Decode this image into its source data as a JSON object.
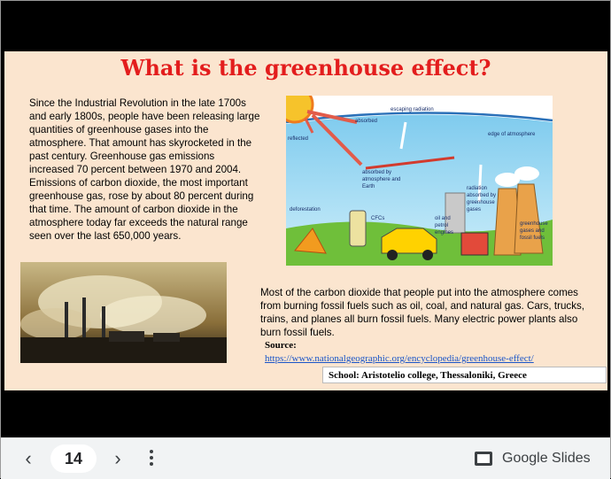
{
  "slide": {
    "title": "What is the greenhouse effect?",
    "paragraph1": "Since the Industrial Revolution in the late 1700s and early 1800s, people have been releasing large quantities of greenhouse gases into the atmosphere. That amount has skyrocketed in the past century. Greenhouse gas emissions increased 70 percent between 1970 and 2004. Emissions of carbon dioxide, the most important greenhouse gas, rose by about 80 percent during that time. The amount of carbon dioxide in the atmosphere today far exceeds the natural range seen over the last 650,000 years.",
    "paragraph2": "Most of the carbon dioxide that people put into the atmosphere comes from burning fossil fuels such as oil, coal, and natural gas. Cars, trucks, trains, and planes all burn fossil fuels. Many electric power plants also burn fossil fuels.",
    "source_label": "Source:",
    "source_url": "https://www.nationalgeographic.org/encyclopedia/greenhouse-effect/",
    "school": "School: Aristotelio college, Thessaloniki, Greece"
  },
  "diagram": {
    "labels": {
      "absorbed": "absorbed",
      "escaping": "escaping radiation",
      "reflected": "reflected",
      "edge": "edge of atmosphere",
      "absorbed_by_1": "absorbed by",
      "absorbed_by_2": "atmosphere and",
      "absorbed_by_3": "Earth",
      "radiation_1": "radiation",
      "radiation_2": "absorbed by",
      "radiation_3": "greenhouse",
      "radiation_4": "gases",
      "deforestation": "deforestation",
      "cfcs": "CFCs",
      "oil_1": "oil and",
      "oil_2": "petrol",
      "oil_3": "engines",
      "fossil_1": "greenhouse",
      "fossil_2": "gases and",
      "fossil_3": "fossil fuels"
    }
  },
  "toolbar": {
    "prev_icon": "‹",
    "next_icon": "›",
    "page_number": "14",
    "app_name": "Google Slides"
  },
  "colors": {
    "slide_bg": "#fbe5cf",
    "title": "#e31d1d",
    "link": "#1a55c8"
  }
}
